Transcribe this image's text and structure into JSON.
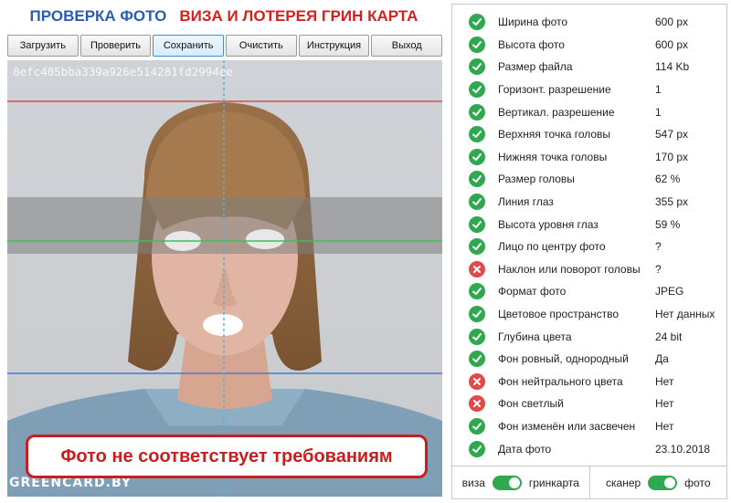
{
  "header": {
    "title_left": "ПРОВЕРКА ФОТО",
    "title_right": "ВИЗА И ЛОТЕРЕЯ ГРИН КАРТА"
  },
  "toolbar": {
    "load": "Загрузить",
    "check": "Проверить",
    "save": "Сохранить",
    "clear": "Очистить",
    "instruction": "Инструкция",
    "exit": "Выход"
  },
  "photo": {
    "hash": "8efc405bba339a926e514281fd2994ee",
    "watermark": "GREENCARD.BY",
    "verdict": "Фото не соответствует требованиям"
  },
  "checks": [
    {
      "label": "Ширина фото",
      "value": "600 px",
      "status": "ok"
    },
    {
      "label": "Высота фото",
      "value": "600 px",
      "status": "ok"
    },
    {
      "label": "Размер файла",
      "value": "114 Kb",
      "status": "ok"
    },
    {
      "label": "Горизонт. разрешение",
      "value": "1",
      "status": "ok"
    },
    {
      "label": "Вертикал. разрешение",
      "value": "1",
      "status": "ok"
    },
    {
      "label": "Верхняя точка головы",
      "value": "547 px",
      "status": "ok"
    },
    {
      "label": "Нижняя точка головы",
      "value": "170 px",
      "status": "ok"
    },
    {
      "label": "Размер головы",
      "value": "62 %",
      "status": "ok"
    },
    {
      "label": "Линия глаз",
      "value": "355 px",
      "status": "ok"
    },
    {
      "label": "Высота уровня глаз",
      "value": "59 %",
      "status": "ok"
    },
    {
      "label": "Лицо по центру фото",
      "value": "?",
      "status": "ok"
    },
    {
      "label": "Наклон или поворот головы",
      "value": "?",
      "status": "bad"
    },
    {
      "label": "Формат фото",
      "value": "JPEG",
      "status": "ok"
    },
    {
      "label": "Цветовое пространство",
      "value": "Нет данных",
      "status": "ok"
    },
    {
      "label": "Глубина цвета",
      "value": "24 bit",
      "status": "ok"
    },
    {
      "label": "Фон ровный, однородный",
      "value": "Да",
      "status": "ok"
    },
    {
      "label": "Фон нейтрального цвета",
      "value": "Нет",
      "status": "bad"
    },
    {
      "label": "Фон светлый",
      "value": "Нет",
      "status": "bad"
    },
    {
      "label": "Фон изменён или засвечен",
      "value": "Нет",
      "status": "ok"
    },
    {
      "label": "Дата фото",
      "value": "23.10.2018",
      "status": "ok"
    }
  ],
  "toggles": {
    "left": {
      "off_label": "виза",
      "on_label": "гринкарта",
      "state": "on"
    },
    "right": {
      "off_label": "сканер",
      "on_label": "фото",
      "state": "on"
    }
  },
  "colors": {
    "ok": "#2fa84f",
    "bad": "#e04a4a",
    "accent": "#3c8fd8",
    "verdict": "#c81e1e"
  }
}
